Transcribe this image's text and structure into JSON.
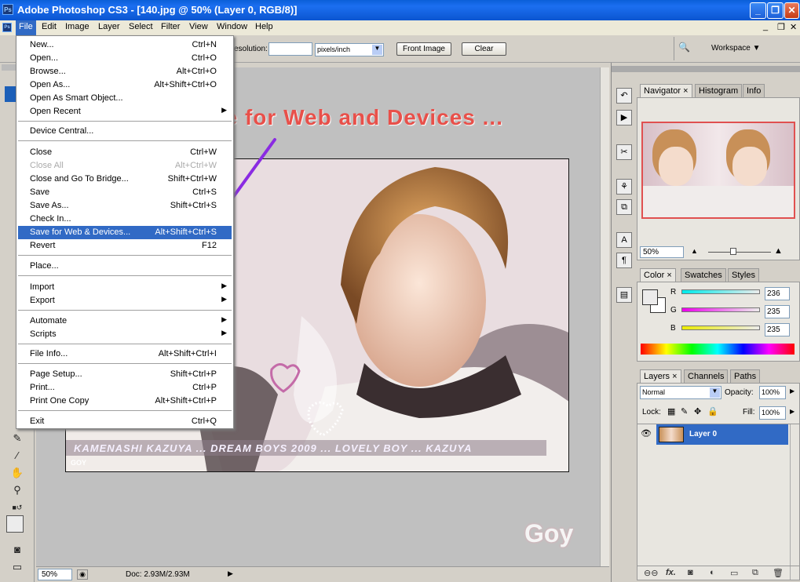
{
  "window": {
    "title": "Adobe Photoshop CS3 - [140.jpg @ 50% (Layer 0, RGB/8)]",
    "app_icon": "Ps"
  },
  "menubar": [
    "File",
    "Edit",
    "Image",
    "Layer",
    "Select",
    "Filter",
    "View",
    "Window",
    "Help"
  ],
  "options": {
    "resolution_label": "esolution:",
    "resolution_value": "",
    "units": "pixels/inch",
    "front_image": "Front Image",
    "clear": "Clear",
    "workspace": "Workspace ▼"
  },
  "file_menu": [
    {
      "label": "New...",
      "shortcut": "Ctrl+N"
    },
    {
      "label": "Open...",
      "shortcut": "Ctrl+O"
    },
    {
      "label": "Browse...",
      "shortcut": "Alt+Ctrl+O"
    },
    {
      "label": "Open As...",
      "shortcut": "Alt+Shift+Ctrl+O"
    },
    {
      "label": "Open As Smart Object...",
      "shortcut": ""
    },
    {
      "label": "Open Recent",
      "shortcut": ""
    },
    {
      "label": "Device Central...",
      "shortcut": ""
    },
    {
      "label": "Close",
      "shortcut": "Ctrl+W"
    },
    {
      "label": "Close All",
      "shortcut": "Alt+Ctrl+W"
    },
    {
      "label": "Close and Go To Bridge...",
      "shortcut": "Shift+Ctrl+W"
    },
    {
      "label": "Save",
      "shortcut": "Ctrl+S"
    },
    {
      "label": "Save As...",
      "shortcut": "Shift+Ctrl+S"
    },
    {
      "label": "Check In...",
      "shortcut": ""
    },
    {
      "label": "Save for Web & Devices...",
      "shortcut": "Alt+Shift+Ctrl+S"
    },
    {
      "label": "Revert",
      "shortcut": "F12"
    },
    {
      "label": "Place...",
      "shortcut": ""
    },
    {
      "label": "Import",
      "shortcut": ""
    },
    {
      "label": "Export",
      "shortcut": ""
    },
    {
      "label": "Automate",
      "shortcut": ""
    },
    {
      "label": "Scripts",
      "shortcut": ""
    },
    {
      "label": "File Info...",
      "shortcut": "Alt+Shift+Ctrl+I"
    },
    {
      "label": "Page Setup...",
      "shortcut": "Shift+Ctrl+P"
    },
    {
      "label": "Print...",
      "shortcut": "Ctrl+P"
    },
    {
      "label": "Print One Copy",
      "shortcut": "Alt+Shift+Ctrl+P"
    },
    {
      "label": "Exit",
      "shortcut": "Ctrl+Q"
    }
  ],
  "annotation": "File --> Save for Web and Devices ...",
  "photo_caption": "KAMENASHI KAZUYA ... DREAM BOYS 2009 ... LOVELY BOY ... KAZUYA",
  "photo_logo": "GOY",
  "watermark": "Goy",
  "status": {
    "zoom": "50%",
    "doc": "Doc: 2.93M/2.93M"
  },
  "navigator": {
    "tabs": [
      "Navigator",
      "Histogram",
      "Info"
    ],
    "zoom": "50%"
  },
  "color": {
    "tabs": [
      "Color",
      "Swatches",
      "Styles"
    ],
    "r_label": "R",
    "g_label": "G",
    "b_label": "B",
    "r": "236",
    "g": "235",
    "b": "235"
  },
  "layers": {
    "tabs": [
      "Layers",
      "Channels",
      "Paths"
    ],
    "blend": "Normal",
    "opacity_label": "Opacity:",
    "opacity": "100%",
    "lock_label": "Lock:",
    "fill_label": "Fill:",
    "fill": "100%",
    "layer_name": "Layer 0"
  },
  "colors": {
    "highlight": "#316ac5",
    "annotation": "#e8504a",
    "arrow": "#8a2be2",
    "layer_selected": "#316ac5"
  }
}
